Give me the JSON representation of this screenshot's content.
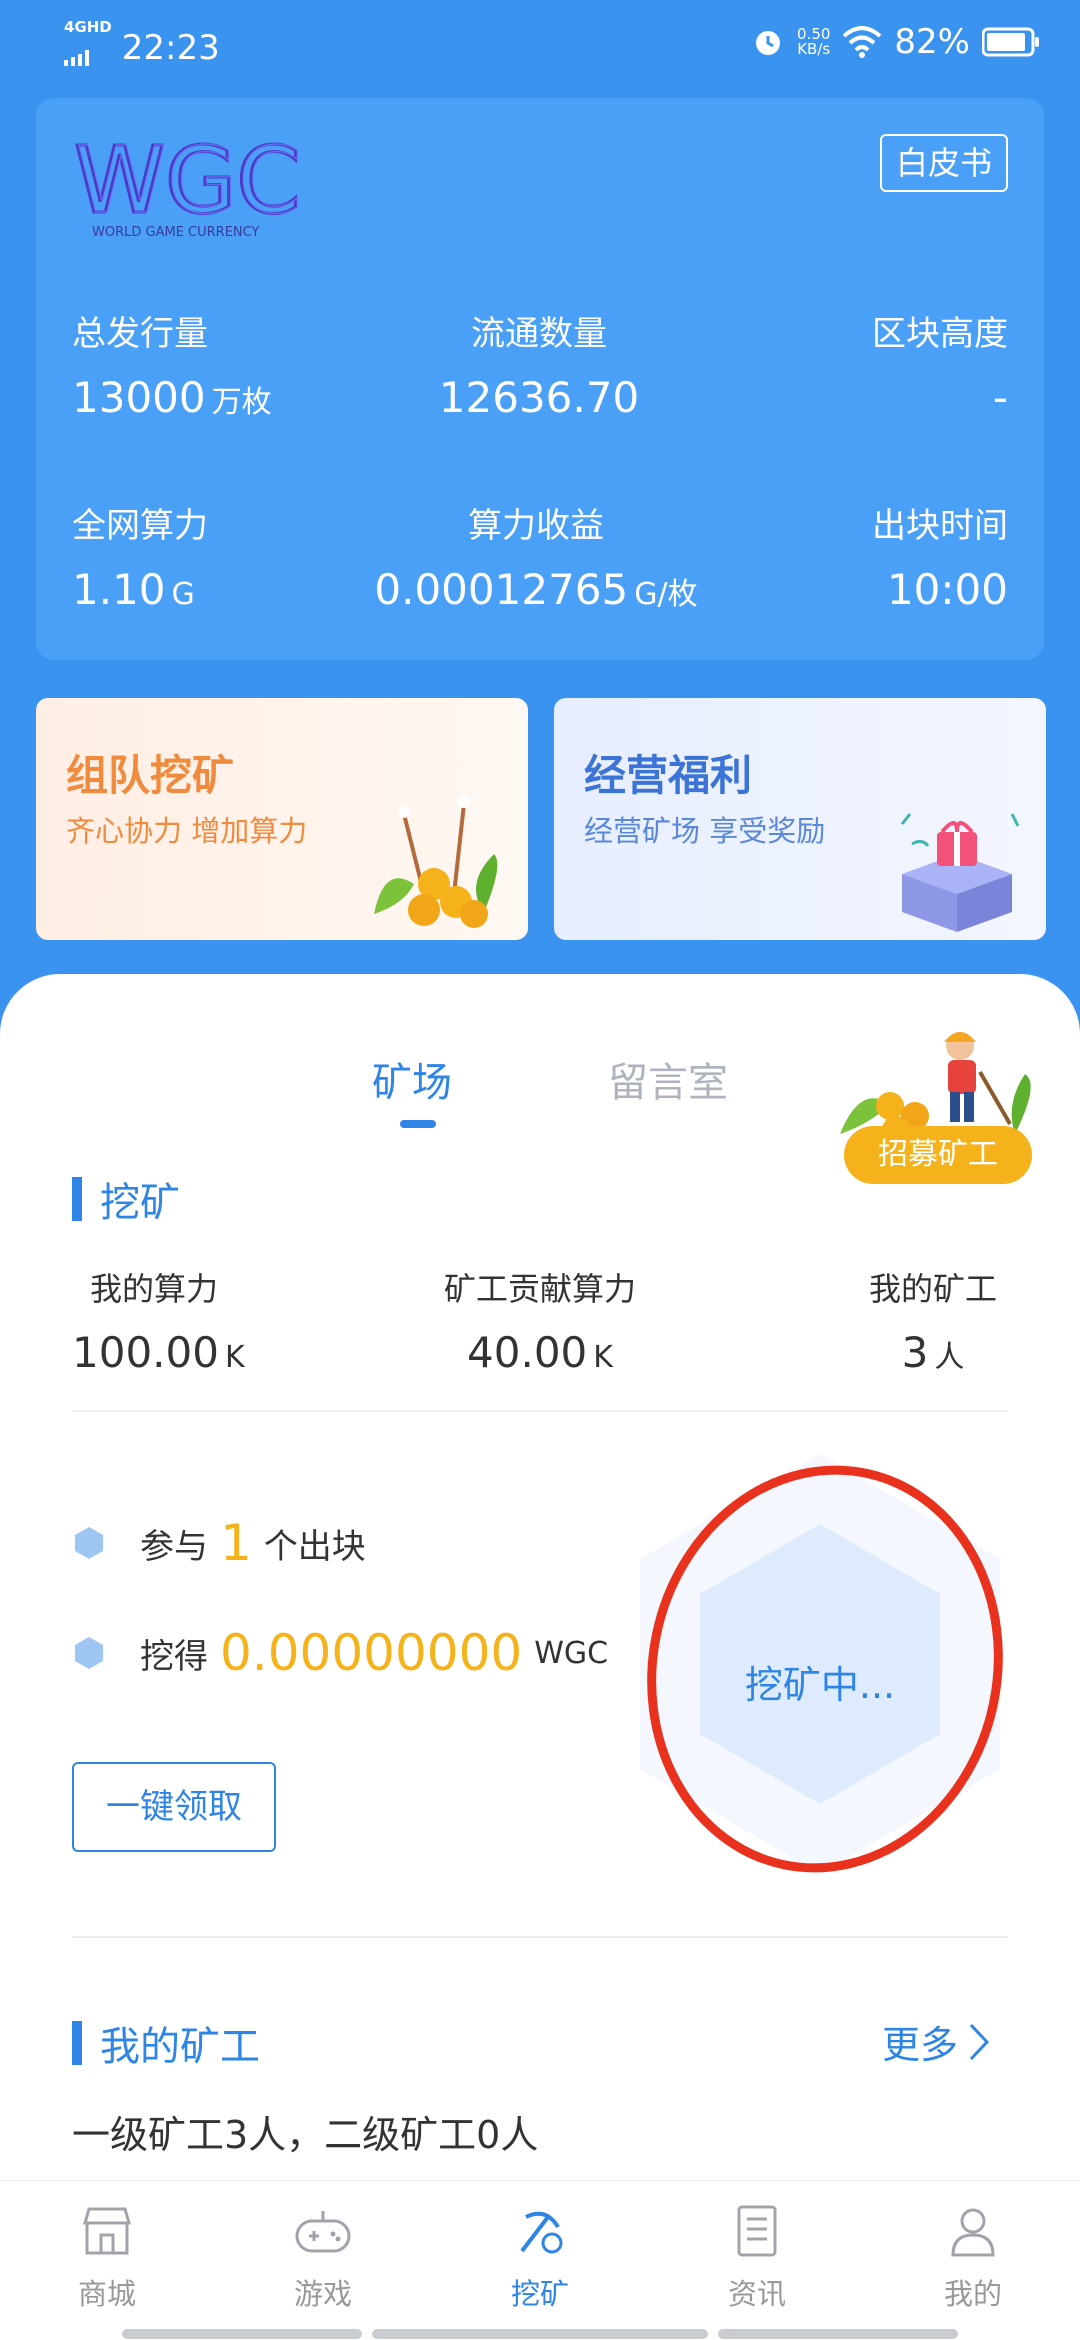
{
  "status_bar": {
    "network": "4GHD",
    "time": "22:23",
    "speed_value": "0.50",
    "speed_unit": "KB/s",
    "battery": "82%"
  },
  "header": {
    "logo_text": "WGC",
    "logo_subtitle": "WORLD GAME CURRENCY",
    "whitepaper_label": "白皮书",
    "stats": [
      {
        "label": "总发行量",
        "value": "13000",
        "unit": "万枚"
      },
      {
        "label": "流通数量",
        "value": "12636.70",
        "unit": ""
      },
      {
        "label": "区块高度",
        "value": "-",
        "unit": ""
      },
      {
        "label": "全网算力",
        "value": "1.10",
        "unit": "G"
      },
      {
        "label": "算力收益",
        "value": "0.00012765",
        "unit": "G/枚"
      },
      {
        "label": "出块时间",
        "value": "10:00",
        "unit": ""
      }
    ]
  },
  "promos": {
    "team": {
      "title": "组队挖矿",
      "subtitle": "齐心协力 增加算力"
    },
    "business": {
      "title": "经营福利",
      "subtitle": "经营矿场 享受奖励"
    }
  },
  "tabs": {
    "active": "矿场",
    "inactive": "留言室"
  },
  "recruit_label": "招募矿工",
  "mining": {
    "section_title": "挖矿",
    "stats": [
      {
        "label": "我的算力",
        "value": "100.00",
        "unit": "K"
      },
      {
        "label": "矿工贡献算力",
        "value": "40.00",
        "unit": "K"
      },
      {
        "label": "我的矿工",
        "value": "3",
        "unit": "人"
      }
    ],
    "participate_prefix": "参与",
    "participate_count": "1",
    "participate_suffix": "个出块",
    "earned_prefix": "挖得",
    "earned_amount": "0.00000000",
    "earned_unit": "WGC",
    "claim_button": "一键领取",
    "status_label": "挖矿中..."
  },
  "miners": {
    "section_title": "我的矿工",
    "more_label": "更多",
    "summary": "一级矿工3人，二级矿工0人"
  },
  "bottom_nav": [
    {
      "label": "商城",
      "icon": "store-icon"
    },
    {
      "label": "游戏",
      "icon": "gamepad-icon"
    },
    {
      "label": "挖矿",
      "icon": "pickaxe-icon"
    },
    {
      "label": "资讯",
      "icon": "news-icon"
    },
    {
      "label": "我的",
      "icon": "user-icon"
    }
  ],
  "colors": {
    "background": "#3B93F0",
    "accent": "#2E85E6",
    "gold": "#F5B21A",
    "annotation_red": "#E8321E"
  }
}
